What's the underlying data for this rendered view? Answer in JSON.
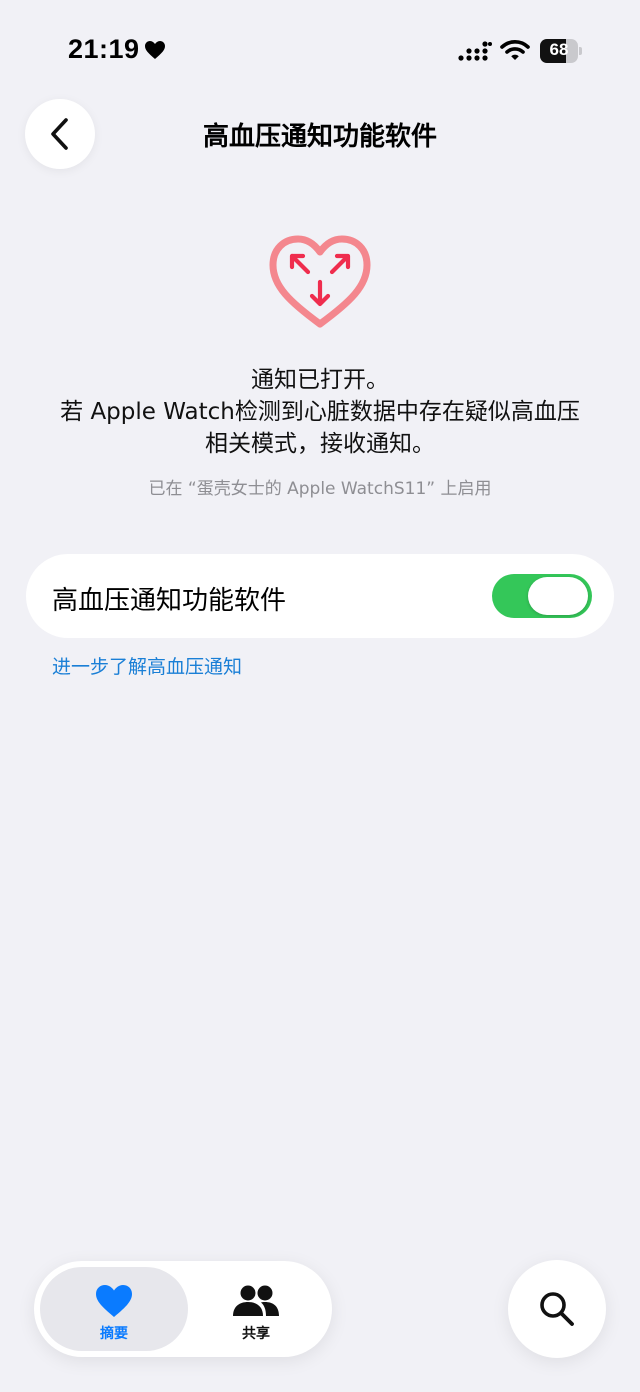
{
  "status_bar": {
    "time": "21:19",
    "heart_icon": "heart-fill-icon",
    "signal_icon": "cellular-signal-icon",
    "wifi_icon": "wifi-icon",
    "battery_level": "68",
    "battery_fraction": 0.68
  },
  "nav": {
    "back_icon": "chevron-left-icon",
    "title": "高血压通知功能软件"
  },
  "hero": {
    "icon": "heart-arrows-icon",
    "message_lines": [
      "通知已打开。",
      "若 Apple Watch检测到心脏数据中存在疑似高血压",
      "相关模式，接收通知。"
    ],
    "enabled_on": "已在 “蛋壳女士的 Apple WatchS11” 上启用"
  },
  "setting": {
    "label": "高血压通知功能软件",
    "toggle_on": true
  },
  "learn_more": "进一步了解高血压通知",
  "tabbar": {
    "tabs": [
      {
        "label": "摘要",
        "icon": "heart-icon",
        "active": true
      },
      {
        "label": "共享",
        "icon": "people-icon",
        "active": false
      }
    ]
  },
  "search_icon": "search-icon",
  "colors": {
    "background": "#f1f1f6",
    "toggle_green": "#34c759",
    "link_blue": "#1a7fd6",
    "tab_active_blue": "#0a7bff",
    "hero_pink": "#f4878e",
    "hero_arrow_red": "#ef2d4e"
  }
}
